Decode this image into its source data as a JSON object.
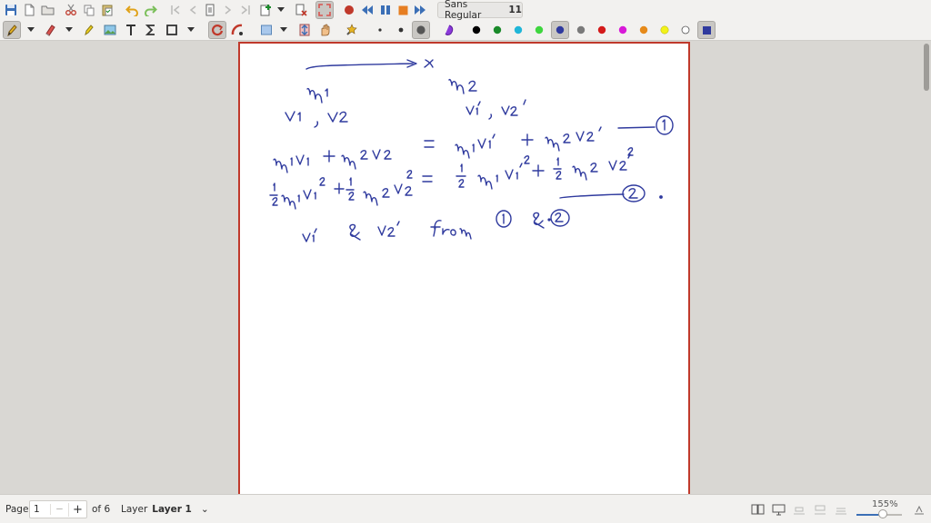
{
  "toolbar": {
    "font_name": "Sans Regular",
    "font_size": "11"
  },
  "colors": {
    "accent_red": "#c0392b",
    "ink_blue": "#2f3a9e",
    "palette": [
      "#000000",
      "#1a8a2a",
      "#20b6d8",
      "#3fd63f",
      "#2f3a9e",
      "#7a7a7a",
      "#d41a1a",
      "#d81ad8",
      "#e68a1a",
      "#f2f21a",
      "#ffffff",
      "#2f3a9e"
    ]
  },
  "statusbar": {
    "page_label": "Page",
    "page_value": "1",
    "page_minus": "−",
    "page_plus": "+",
    "page_of": "of 6",
    "layer_label": "Layer",
    "layer_value": "Layer 1",
    "layer_arrow": "⌄",
    "zoom": "155%",
    "zoom_fraction": 0.55
  }
}
